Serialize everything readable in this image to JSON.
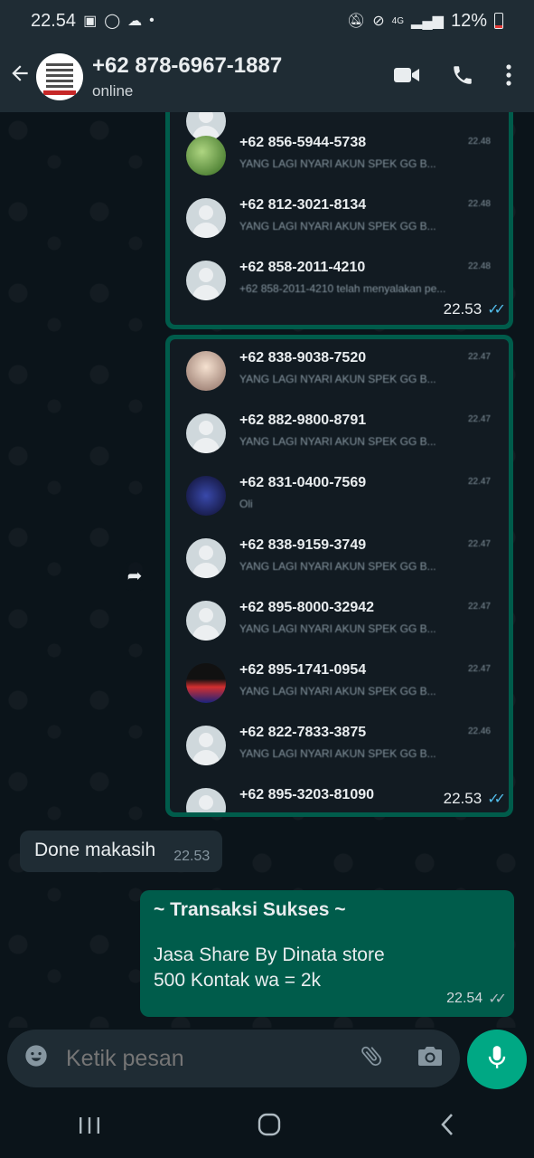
{
  "status": {
    "time": "22.54",
    "battery": "12%",
    "network": "4G"
  },
  "header": {
    "title": "+62 878-6967-1887",
    "subtitle": "online"
  },
  "image1": {
    "time": "22.53",
    "rows": [
      {
        "name": "+62 856-5944-5738",
        "msg": "YANG LAGI NYARI AKUN SPEK GG B...",
        "time": "22.48"
      },
      {
        "name": "+62 812-3021-8134",
        "msg": "YANG LAGI NYARI AKUN SPEK GG B...",
        "time": "22.48"
      },
      {
        "name": "+62 858-2011-4210",
        "msg": "+62 858-2011-4210 telah menyalakan pe...",
        "time": "22.48"
      }
    ]
  },
  "image2": {
    "time": "22.53",
    "rows": [
      {
        "name": "+62 838-9038-7520",
        "msg": "YANG LAGI NYARI AKUN SPEK GG B...",
        "time": "22.47"
      },
      {
        "name": "+62 882-9800-8791",
        "msg": "YANG LAGI NYARI AKUN SPEK GG B...",
        "time": "22.47"
      },
      {
        "name": "+62 831-0400-7569",
        "msg": "Oli",
        "time": "22.47"
      },
      {
        "name": "+62 838-9159-3749",
        "msg": "YANG LAGI NYARI AKUN SPEK GG B...",
        "time": "22.47"
      },
      {
        "name": "+62 895-8000-32942",
        "msg": "YANG LAGI NYARI AKUN SPEK GG B...",
        "time": "22.47"
      },
      {
        "name": "+62 895-1741-0954",
        "msg": "YANG LAGI NYARI AKUN SPEK GG B...",
        "time": "22.47"
      },
      {
        "name": "+62 822-7833-3875",
        "msg": "YANG LAGI NYARI AKUN SPEK GG B...",
        "time": "22.46"
      },
      {
        "name": "+62 895-3203-81090",
        "msg": "",
        "time": ""
      }
    ]
  },
  "incoming": {
    "text": "Done makasih",
    "time": "22.53"
  },
  "outgoing": {
    "line1": "~ Transaksi Sukses ~",
    "line2": "Jasa Share By Dinata store",
    "line3": "500 Kontak wa = 2k",
    "time": "22.54"
  },
  "composer": {
    "placeholder": "Ketik pesan"
  },
  "icons": {
    "status_left": [
      "gallery-icon",
      "whatsapp-icon",
      "cloud-icon",
      "dot-icon"
    ],
    "status_right": [
      "mute-icon",
      "dnd-icon",
      "signal-icon",
      "battery-icon"
    ],
    "header": [
      "back-arrow-icon",
      "video-call-icon",
      "voice-call-icon",
      "more-icon"
    ],
    "composer": [
      "emoji-icon",
      "attach-icon",
      "camera-icon",
      "mic-icon"
    ]
  },
  "colors": {
    "accent": "#00a884",
    "outgoing_bubble": "#005c4b",
    "incoming_bubble": "#1f2c34",
    "read_tick": "#53bdeb"
  }
}
